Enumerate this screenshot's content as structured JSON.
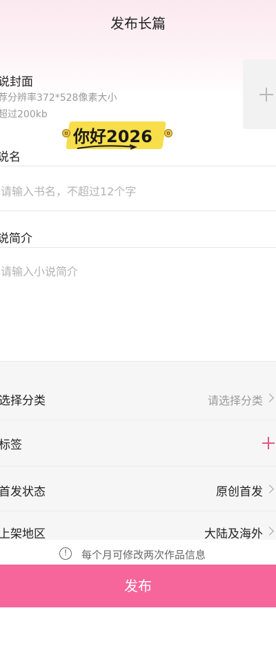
{
  "header": {
    "title": "发布长篇"
  },
  "cover": {
    "title": "说封面",
    "hint_line1": "荐分辨率372*528像素大小",
    "hint_line2": "超过200kb"
  },
  "banner": {
    "text": "你好2026"
  },
  "book_name": {
    "label": "说名",
    "placeholder": "请输入书名，不超过12个字"
  },
  "intro": {
    "label": "说简介",
    "placeholder": "请输入小说简介"
  },
  "options": {
    "category": {
      "label": "选择分类",
      "value": "请选择分类"
    },
    "tags": {
      "label": "标签"
    },
    "status": {
      "label": "首发状态",
      "value": "原创首发"
    },
    "region": {
      "label": "上架地区",
      "value": "大陆及海外"
    }
  },
  "notice": {
    "icon": "info-icon",
    "text": "每个月可修改两次作品信息"
  },
  "publish_button": {
    "label": "发布",
    "color": "#f6669a"
  },
  "colors": {
    "accent": "#e0578a",
    "placeholder": "#b3b3b3",
    "muted": "#9a9a9a"
  }
}
